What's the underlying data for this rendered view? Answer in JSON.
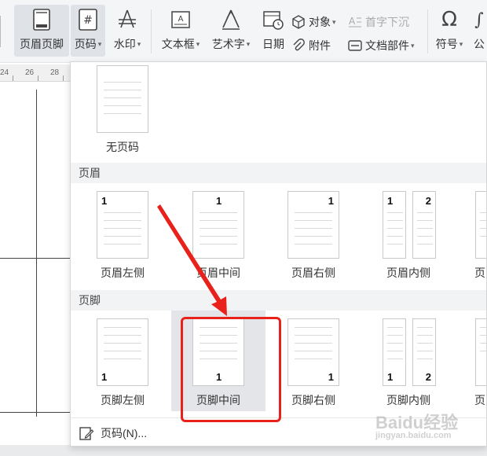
{
  "ribbon": {
    "header_footer": "页眉页脚",
    "page_number": "页码",
    "watermark": "水印",
    "textbox": "文本框",
    "wordart": "艺术字",
    "date": "日期",
    "object": "对象",
    "attachment": "附件",
    "dropcap": "首字下沉",
    "doc_parts": "文档部件",
    "symbol": "符号",
    "formula": "公"
  },
  "ruler": {
    "ticks": [
      "24",
      "26",
      "28"
    ]
  },
  "panel": {
    "none_label": "无页码",
    "header_section": "页眉",
    "footer_section": "页脚",
    "header_items": [
      {
        "label": "页眉左侧",
        "num": "1"
      },
      {
        "label": "页眉中间",
        "num": "1"
      },
      {
        "label": "页眉右侧",
        "num": "1"
      },
      {
        "label": "页眉内侧",
        "num_left": "1",
        "num_right": "2"
      }
    ],
    "footer_items": [
      {
        "label": "页脚左侧",
        "num": "1"
      },
      {
        "label": "页脚中间",
        "num": "1"
      },
      {
        "label": "页脚右侧",
        "num": "1"
      },
      {
        "label": "页脚内侧",
        "num_left": "1",
        "num_right": "2"
      }
    ],
    "edge_label": "页",
    "more_label": "页码(N)..."
  },
  "colors": {
    "annotation": "#e8211a",
    "active_bg": "#dfe2e7",
    "section_bg": "#f2f3f5"
  },
  "watermark": {
    "text": "Baidu经验",
    "sub": "jingyan.baidu.com"
  }
}
